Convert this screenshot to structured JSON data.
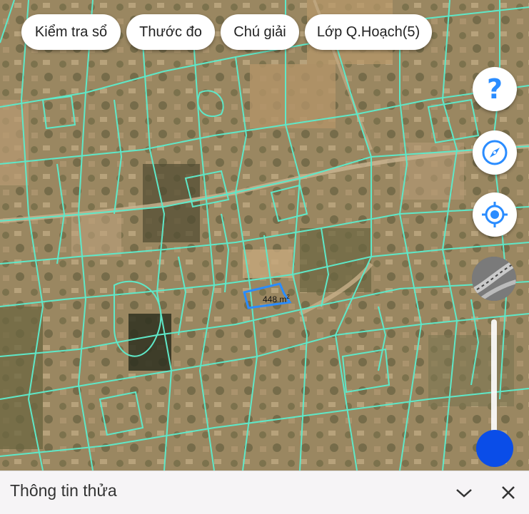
{
  "toolbar": {
    "check_book_label": "Kiểm tra sổ",
    "measure_label": "Thước đo",
    "legend_label": "Chú giải",
    "planning_layer_label": "Lớp Q.Hoạch(5)"
  },
  "map_controls": {
    "help_icon": "question-mark",
    "compass_icon": "compass",
    "locate_icon": "gps-target",
    "layer_thumbnail_icon": "satellite-road-thumbnail",
    "opacity_slider_value": 1.0
  },
  "parcel": {
    "area_value": "448",
    "area_unit": "m",
    "area_exponent": "2",
    "highlight_color": "#2a8cff"
  },
  "colors": {
    "parcel_lines": "#5ee8c8",
    "slider_knob": "#0a4de8",
    "accent_blue": "#2a8cff"
  },
  "bottom_sheet": {
    "title": "Thông tin thửa",
    "expand_icon": "chevron-down",
    "close_icon": "close-x"
  }
}
